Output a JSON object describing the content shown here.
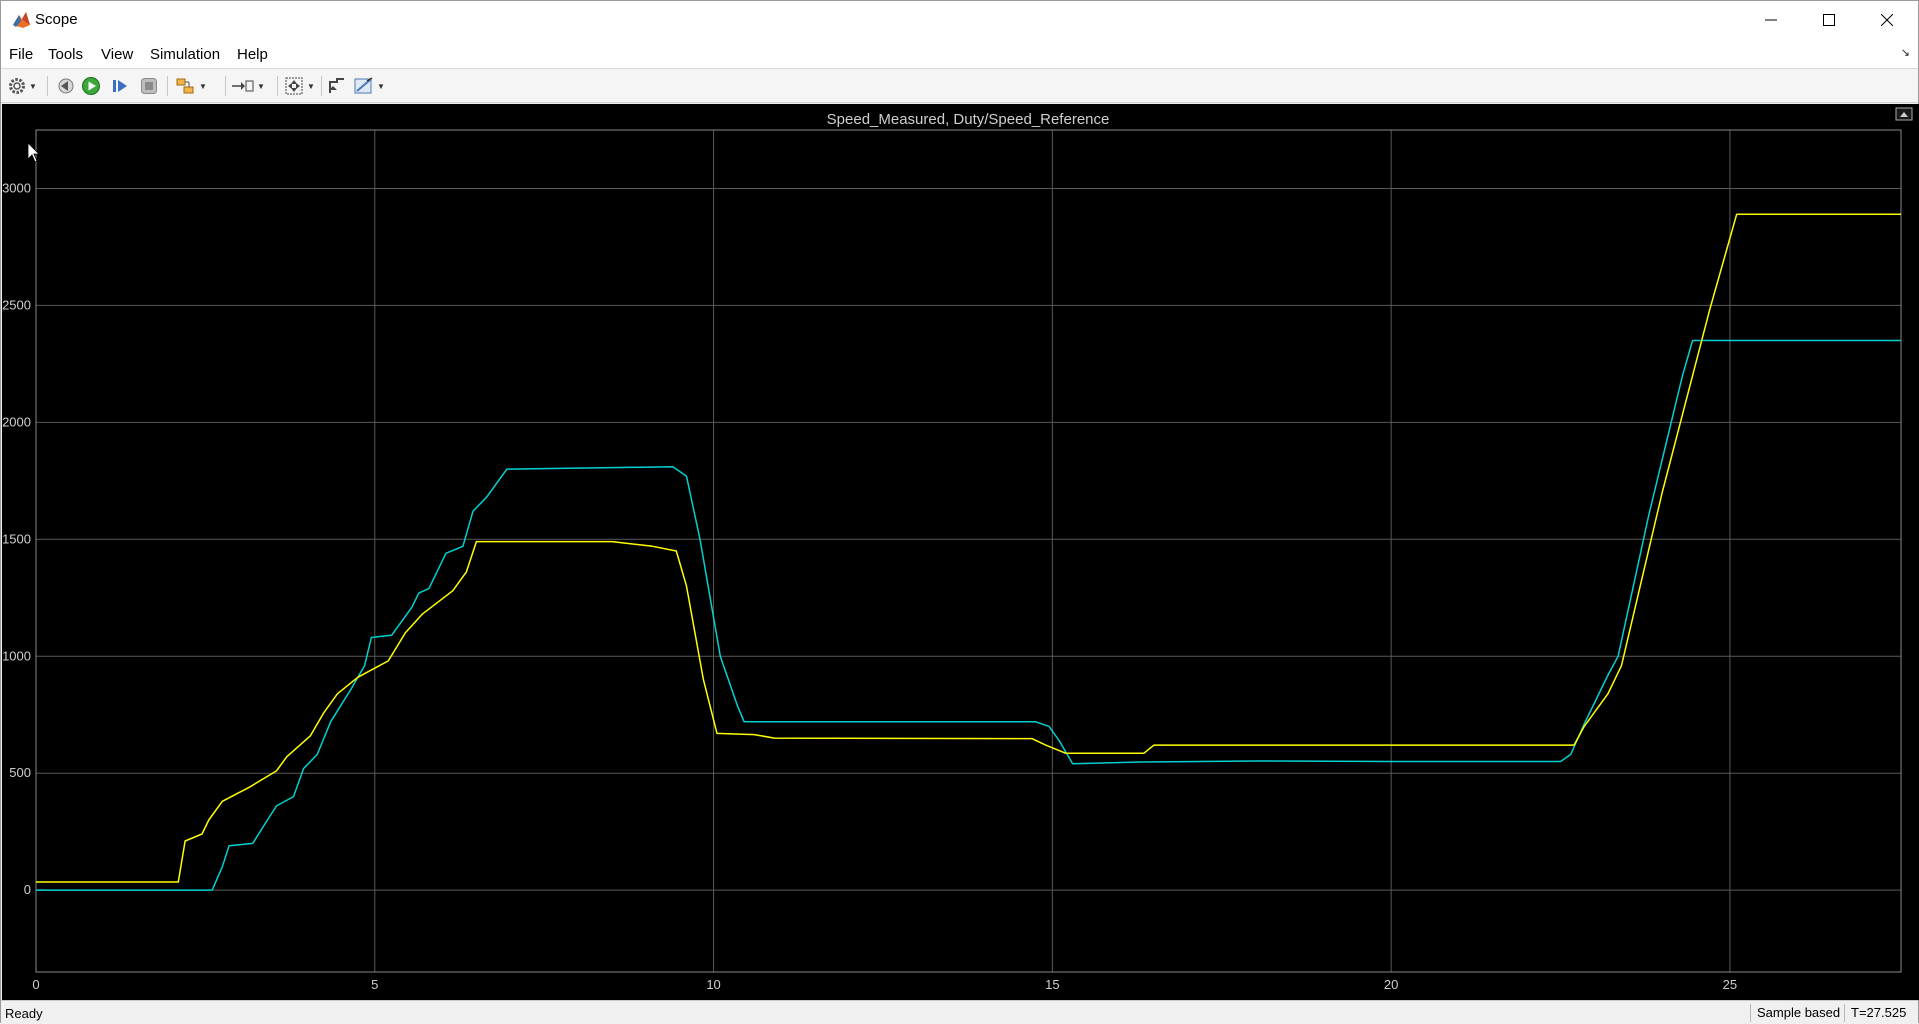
{
  "window": {
    "title": "Scope"
  },
  "menu": {
    "file": "File",
    "tools": "Tools",
    "view": "View",
    "simulation": "Simulation",
    "help": "Help"
  },
  "status": {
    "ready": "Ready",
    "mode": "Sample based",
    "time": "T=27.525"
  },
  "colors": {
    "background": "#000000",
    "grid": "#5a5a5a",
    "series1": "#00d2d2",
    "series2": "#ffff00",
    "tick": "#cfcfcf"
  },
  "chart_data": {
    "type": "line",
    "title": "Speed_Measured, Duty/Speed_Reference",
    "xlim": [
      0,
      27.525
    ],
    "ylim": [
      -350,
      3250
    ],
    "xticks": [
      0,
      5,
      10,
      15,
      20,
      25
    ],
    "yticks": [
      0,
      500,
      1000,
      1500,
      2000,
      2500,
      3000
    ],
    "grid": true,
    "series": [
      {
        "color": "#00d2d2",
        "points": [
          [
            0,
            0
          ],
          [
            2.6,
            0
          ],
          [
            2.75,
            100
          ],
          [
            2.85,
            190
          ],
          [
            3.2,
            200
          ],
          [
            3.35,
            270
          ],
          [
            3.55,
            360
          ],
          [
            3.8,
            400
          ],
          [
            3.95,
            520
          ],
          [
            4.15,
            580
          ],
          [
            4.35,
            720
          ],
          [
            4.65,
            860
          ],
          [
            4.85,
            960
          ],
          [
            4.95,
            1080
          ],
          [
            5.25,
            1090
          ],
          [
            5.55,
            1210
          ],
          [
            5.65,
            1270
          ],
          [
            5.8,
            1290
          ],
          [
            6.05,
            1440
          ],
          [
            6.3,
            1470
          ],
          [
            6.45,
            1620
          ],
          [
            6.65,
            1680
          ],
          [
            6.95,
            1800
          ],
          [
            9.4,
            1810
          ],
          [
            9.6,
            1770
          ],
          [
            9.8,
            1500
          ],
          [
            10.1,
            1000
          ],
          [
            10.35,
            790
          ],
          [
            10.45,
            720
          ],
          [
            13.2,
            720
          ],
          [
            14.75,
            720
          ],
          [
            14.95,
            700
          ],
          [
            15.1,
            640
          ],
          [
            15.3,
            540
          ],
          [
            16.3,
            548
          ],
          [
            18,
            552
          ],
          [
            20,
            550
          ],
          [
            22.5,
            550
          ],
          [
            22.65,
            580
          ],
          [
            22.85,
            710
          ],
          [
            23.2,
            920
          ],
          [
            23.35,
            1000
          ],
          [
            23.8,
            1600
          ],
          [
            24.3,
            2200
          ],
          [
            24.45,
            2350
          ],
          [
            27.525,
            2350
          ]
        ]
      },
      {
        "color": "#ffff00",
        "points": [
          [
            0,
            35
          ],
          [
            2.1,
            35
          ],
          [
            2.2,
            210
          ],
          [
            2.45,
            240
          ],
          [
            2.55,
            300
          ],
          [
            2.75,
            380
          ],
          [
            3.15,
            440
          ],
          [
            3.55,
            510
          ],
          [
            3.7,
            570
          ],
          [
            4.05,
            660
          ],
          [
            4.25,
            760
          ],
          [
            4.45,
            840
          ],
          [
            4.75,
            910
          ],
          [
            5.2,
            980
          ],
          [
            5.45,
            1100
          ],
          [
            5.7,
            1180
          ],
          [
            6.15,
            1280
          ],
          [
            6.35,
            1360
          ],
          [
            6.5,
            1490
          ],
          [
            8.5,
            1490
          ],
          [
            9.1,
            1470
          ],
          [
            9.45,
            1450
          ],
          [
            9.6,
            1300
          ],
          [
            9.85,
            900
          ],
          [
            10.05,
            670
          ],
          [
            10.6,
            665
          ],
          [
            10.9,
            650
          ],
          [
            14.7,
            648
          ],
          [
            14.9,
            620
          ],
          [
            15.2,
            585
          ],
          [
            16.35,
            585
          ],
          [
            16.5,
            620
          ],
          [
            20,
            620
          ],
          [
            22.7,
            620
          ],
          [
            22.85,
            700
          ],
          [
            23.2,
            840
          ],
          [
            23.4,
            960
          ],
          [
            24,
            1700
          ],
          [
            24.7,
            2480
          ],
          [
            25.1,
            2890
          ],
          [
            27.525,
            2890
          ]
        ]
      }
    ]
  }
}
